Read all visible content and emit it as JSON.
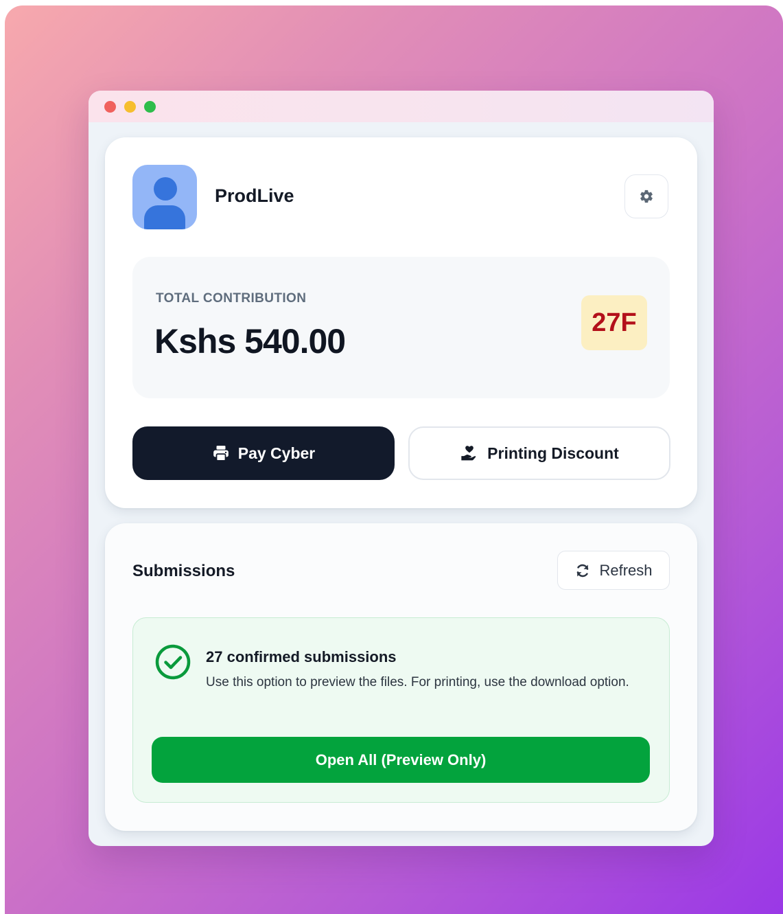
{
  "profile": {
    "username": "ProdLive",
    "avatar_icon": "user-avatar-icon",
    "settings_icon": "gear-icon"
  },
  "contribution": {
    "label": "TOTAL CONTRIBUTION",
    "amount": "Kshs 540.00",
    "badge": "27F"
  },
  "actions": {
    "pay_label": "Pay Cyber",
    "pay_icon": "printer-icon",
    "discount_label": "Printing Discount",
    "discount_icon": "hand-heart-icon"
  },
  "submissions": {
    "title": "Submissions",
    "refresh_label": "Refresh",
    "refresh_icon": "refresh-icon",
    "confirmed_title": "27 confirmed submissions",
    "confirmed_desc": "Use this option to preview the files. For printing, use the download option.",
    "confirmed_icon": "check-circle-icon",
    "open_all_label": "Open All (Preview Only)"
  },
  "colors": {
    "primary_dark": "#121a2b",
    "success_green": "#03a33d",
    "badge_bg": "#fcefc2",
    "badge_text": "#b3101a",
    "avatar_bg": "#93b6f7",
    "avatar_fg": "#3674dc"
  }
}
